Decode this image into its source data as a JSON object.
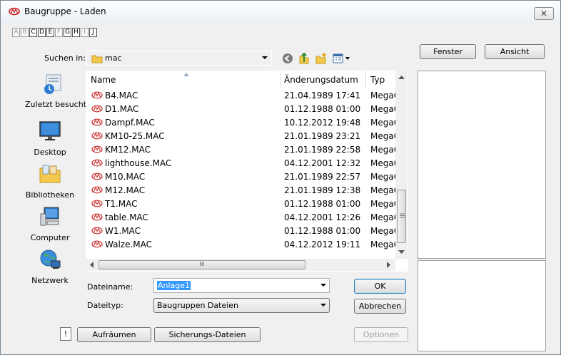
{
  "window": {
    "title": "Baugruppe - Laden",
    "close_symbol": "✕"
  },
  "letters": [
    {
      "char": "A",
      "active": false
    },
    {
      "char": "B",
      "active": false
    },
    {
      "char": "C",
      "active": true
    },
    {
      "char": "D",
      "active": true
    },
    {
      "char": "E",
      "active": true
    },
    {
      "char": "F",
      "active": false
    },
    {
      "char": "G",
      "active": true
    },
    {
      "char": "H",
      "active": true
    },
    {
      "char": "I",
      "active": false
    },
    {
      "char": "J",
      "active": true
    }
  ],
  "look_in": {
    "label": "Suchen in:",
    "value": "mac"
  },
  "buttons": {
    "fenster": "Fenster",
    "ansicht": "Ansicht",
    "ok": "OK",
    "abbrechen": "Abbrechen",
    "optionen": "Optionen",
    "aufraeumen": "Aufräumen",
    "sicherung": "Sicherungs-Dateien",
    "checkbox_mark": "!"
  },
  "places": [
    {
      "label": "Zuletzt besucht",
      "icon": "recent-places-icon"
    },
    {
      "label": "Desktop",
      "icon": "desktop-icon"
    },
    {
      "label": "Bibliotheken",
      "icon": "libraries-icon"
    },
    {
      "label": "Computer",
      "icon": "computer-icon"
    },
    {
      "label": "Netzwerk",
      "icon": "network-icon"
    }
  ],
  "columns": {
    "name": "Name",
    "date": "Änderungsdatum",
    "type": "Typ"
  },
  "files": [
    {
      "name": "B4.MAC",
      "date": "21.04.1989 17:41",
      "type": "MegaC"
    },
    {
      "name": "D1.MAC",
      "date": "01.12.1988 01:00",
      "type": "MegaC"
    },
    {
      "name": "Dampf.MAC",
      "date": "10.12.2012 19:48",
      "type": "MegaC"
    },
    {
      "name": "KM10-25.MAC",
      "date": "21.01.1989 23:21",
      "type": "MegaC"
    },
    {
      "name": "KM12.MAC",
      "date": "21.01.1989 22:58",
      "type": "MegaC"
    },
    {
      "name": "lighthouse.MAC",
      "date": "04.12.2001 12:32",
      "type": "MegaC"
    },
    {
      "name": "M10.MAC",
      "date": "21.01.1989 22:57",
      "type": "MegaC"
    },
    {
      "name": "M12.MAC",
      "date": "21.01.1989 12:38",
      "type": "MegaC"
    },
    {
      "name": "T1.MAC",
      "date": "01.12.1988 01:00",
      "type": "MegaC"
    },
    {
      "name": "table.MAC",
      "date": "04.12.2001 12:26",
      "type": "MegaC"
    },
    {
      "name": "W1.MAC",
      "date": "01.12.1988 01:00",
      "type": "MegaC"
    },
    {
      "name": "Walze.MAC",
      "date": "04.12.2012 19:11",
      "type": "MegaC"
    }
  ],
  "filename": {
    "label": "Dateiname:",
    "value": "Anlage1"
  },
  "filetype": {
    "label": "Dateityp:",
    "value": "Baugruppen Dateien"
  },
  "hscroll_grip": "III",
  "colors": {
    "accent": "#3399ff",
    "file_icon": "#d04040"
  }
}
